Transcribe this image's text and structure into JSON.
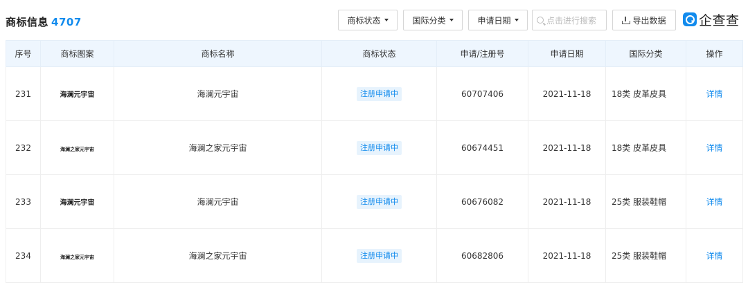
{
  "section": {
    "title": "商标信息",
    "count": "4707"
  },
  "toolbar": {
    "status_filter": "商标状态",
    "class_filter": "国际分类",
    "date_filter": "申请日期",
    "search_placeholder": "点击进行搜索",
    "export_label": "导出数据",
    "logo_text": "企查查"
  },
  "table": {
    "columns": [
      "序号",
      "商标图案",
      "商标名称",
      "商标状态",
      "申请/注册号",
      "申请日期",
      "国际分类",
      "操作"
    ],
    "rows": [
      {
        "index": "231",
        "pattern": "海澜元宇宙",
        "name": "海澜元宇宙",
        "status": "注册申请中",
        "reg_no": "60707406",
        "date": "2021-11-18",
        "class": "18类 皮革皮具",
        "action": "详情"
      },
      {
        "index": "232",
        "pattern": "海澜之家元宇宙",
        "name": "海澜之家元宇宙",
        "status": "注册申请中",
        "reg_no": "60674451",
        "date": "2021-11-18",
        "class": "18类 皮革皮具",
        "action": "详情"
      },
      {
        "index": "233",
        "pattern": "海澜元宇宙",
        "name": "海澜元宇宙",
        "status": "注册申请中",
        "reg_no": "60676082",
        "date": "2021-11-18",
        "class": "25类 服装鞋帽",
        "action": "详情"
      },
      {
        "index": "234",
        "pattern": "海澜之家元宇宙",
        "name": "海澜之家元宇宙",
        "status": "注册申请中",
        "reg_no": "60682806",
        "date": "2021-11-18",
        "class": "25类 服装鞋帽",
        "action": "详情"
      }
    ]
  },
  "colors": {
    "accent": "#128bed",
    "header_bg": "#eef6fe",
    "tag_bg": "#e7f3fd"
  },
  "icons": {
    "search": "search-icon",
    "export": "download-icon",
    "logo": "qcc-logo-icon"
  }
}
